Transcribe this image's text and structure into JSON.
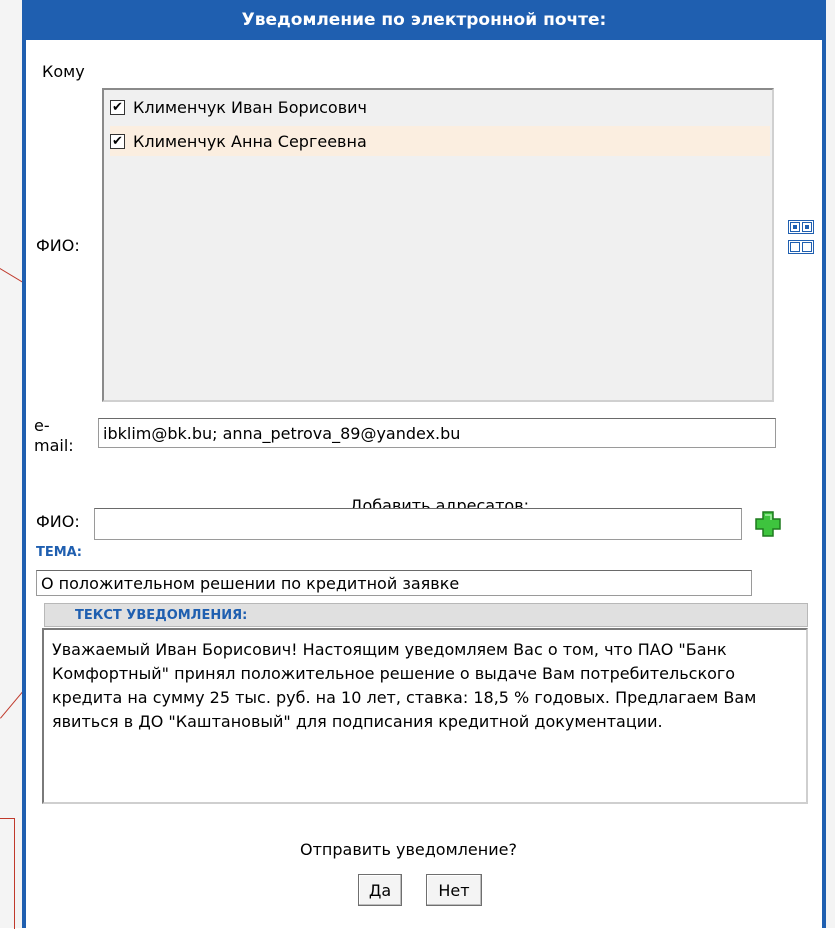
{
  "dialog": {
    "title": "Уведомление по электронной почте:",
    "colors": {
      "accent": "#1f5fb0",
      "selected_row": "#fbeee0",
      "add_icon": "#3ec43e"
    }
  },
  "recipients": {
    "to_label": "Кому",
    "fio_label": "ФИО:",
    "items": [
      {
        "name": "Клименчук Иван Борисович",
        "checked": true
      },
      {
        "name": "Клименчук Анна Сергеевна",
        "checked": true
      }
    ],
    "email_label": "e-mail:",
    "email_value": "ibklim@bk.bu; anna_petrova_89@yandex.bu",
    "icons": {
      "select_all": "select-all-grid-icon",
      "deselect_all": "deselect-all-grid-icon"
    }
  },
  "add_recipients": {
    "heading": "Добавить адресатов:",
    "fio_label": "ФИО:",
    "fio_value": "",
    "add_icon": "plus-icon"
  },
  "subject": {
    "label": "ТЕМА:",
    "value": "О положительном решении по кредитной заявке"
  },
  "message": {
    "label": "ТЕКСТ УВЕДОМЛЕНИЯ:",
    "body": "Уважаемый Иван Борисович! Настоящим уведомляем Вас о том, что ПАО \"Банк Комфортный\" принял положительное решение о выдаче Вам потребительского кредита на сумму 25 тыс. руб. на 10 лет, ставка: 18,5 % годовых. Предлагаем Вам явиться в ДО \"Каштановый\" для подписания кредитной документации."
  },
  "confirm": {
    "question": "Отправить уведомление?",
    "yes": "Да",
    "no": "Нет"
  }
}
